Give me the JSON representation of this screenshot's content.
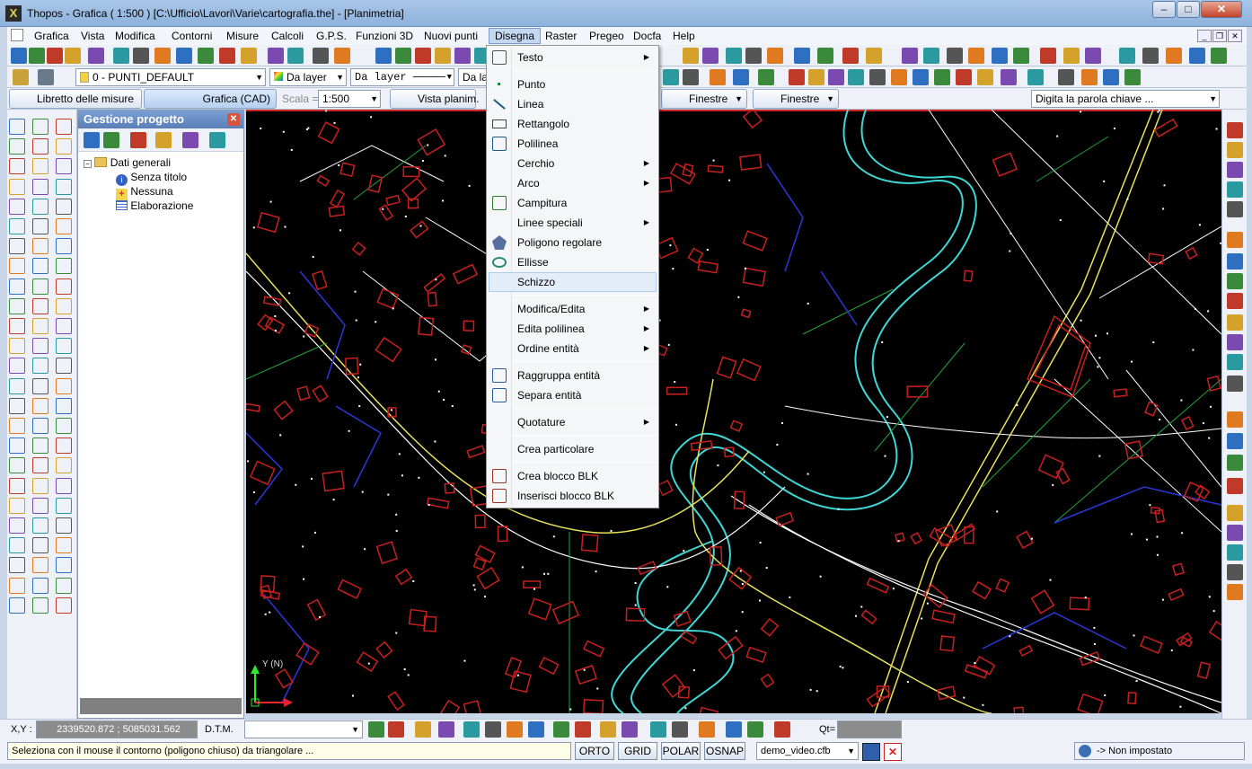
{
  "window": {
    "title": "Thopos - Grafica ( 1:500 ) [C:\\Ufficio\\Lavori\\Varie\\cartografia.the] - [Planimetria]",
    "minimize": "–",
    "maximize": "□",
    "close": "✕"
  },
  "menubar": {
    "items": [
      "Grafica",
      "Vista",
      "Modifica",
      "Contorni",
      "Misure",
      "Calcoli",
      "G.P.S.",
      "Funzioni 3D",
      "Nuovi punti",
      "Disegna",
      "Raster",
      "Pregeo",
      "Docfa",
      "Help"
    ],
    "active": "Disegna"
  },
  "toolbar2": {
    "layer": "0 - PUNTI_DEFAULT",
    "color": "Da layer",
    "linetype": "Da layer",
    "lineweight": "Da lay"
  },
  "toolbar3": {
    "libretto": "Libretto delle misure",
    "grafica": "Grafica (CAD)",
    "scala_label": "Scala =",
    "scala_value": "1:500",
    "vista": "Vista planim.",
    "finestre1": "Finestre",
    "finestre2": "Finestre",
    "search_placeholder": "Digita la parola chiave ..."
  },
  "panel": {
    "title": "Gestione progetto",
    "tree": {
      "root": "Dati generali",
      "children": [
        "Senza titolo",
        "Nessuna",
        "Elaborazione"
      ]
    }
  },
  "disegna_menu": {
    "groups": [
      [
        {
          "label": "Testo",
          "sub": true,
          "icon": "text-icon"
        }
      ],
      [
        {
          "label": "Punto",
          "sub": false,
          "icon": "point-icon"
        },
        {
          "label": "Linea",
          "sub": false,
          "icon": "line-icon"
        },
        {
          "label": "Rettangolo",
          "sub": false,
          "icon": "rectangle-icon"
        },
        {
          "label": "Polilinea",
          "sub": false,
          "icon": "polyline-icon"
        },
        {
          "label": "Cerchio",
          "sub": true,
          "icon": ""
        },
        {
          "label": "Arco",
          "sub": true,
          "icon": ""
        },
        {
          "label": "Campitura",
          "sub": false,
          "icon": "hatch-icon"
        },
        {
          "label": "Linee speciali",
          "sub": true,
          "icon": ""
        },
        {
          "label": "Poligono regolare",
          "sub": false,
          "icon": "polygon-icon"
        },
        {
          "label": "Ellisse",
          "sub": false,
          "icon": "ellipse-icon"
        },
        {
          "label": "Schizzo",
          "sub": false,
          "icon": "",
          "highlight": true
        }
      ],
      [
        {
          "label": "Modifica/Edita",
          "sub": true,
          "icon": ""
        },
        {
          "label": "Edita polilinea",
          "sub": true,
          "icon": ""
        },
        {
          "label": "Ordine entità",
          "sub": true,
          "icon": ""
        }
      ],
      [
        {
          "label": "Raggruppa entità",
          "sub": false,
          "icon": "group-icon"
        },
        {
          "label": "Separa entità",
          "sub": false,
          "icon": "ungroup-icon"
        }
      ],
      [
        {
          "label": "Quotature",
          "sub": true,
          "icon": ""
        }
      ],
      [
        {
          "label": "Crea particolare",
          "sub": false,
          "icon": ""
        }
      ],
      [
        {
          "label": "Crea blocco BLK",
          "sub": false,
          "icon": "create-block-icon"
        },
        {
          "label": "Inserisci blocco BLK",
          "sub": false,
          "icon": "insert-block-icon"
        }
      ]
    ]
  },
  "status": {
    "xy_label": "X,Y :",
    "xy_value": "2339520.872 ; 5085031.562",
    "dtm_label": "D.T.M.",
    "qt_label": "Qt=",
    "message": "Seleziona con il mouse il contorno (poligono chiuso) da triangolare ...",
    "orto": "ORTO",
    "grid": "GRID",
    "polar": "POLAR",
    "osnap": "OSNAP",
    "file": "demo_video.cfb",
    "impostato": "-> Non impostato"
  },
  "colors": {
    "canvas_bg": "#000000",
    "buildings": "#c8201e",
    "rivers": "#3fd6d6",
    "roads": "#e9e25a",
    "parcels": "#ffffff",
    "boundaries": "#2c36d8",
    "green_lines": "#22a33a"
  }
}
